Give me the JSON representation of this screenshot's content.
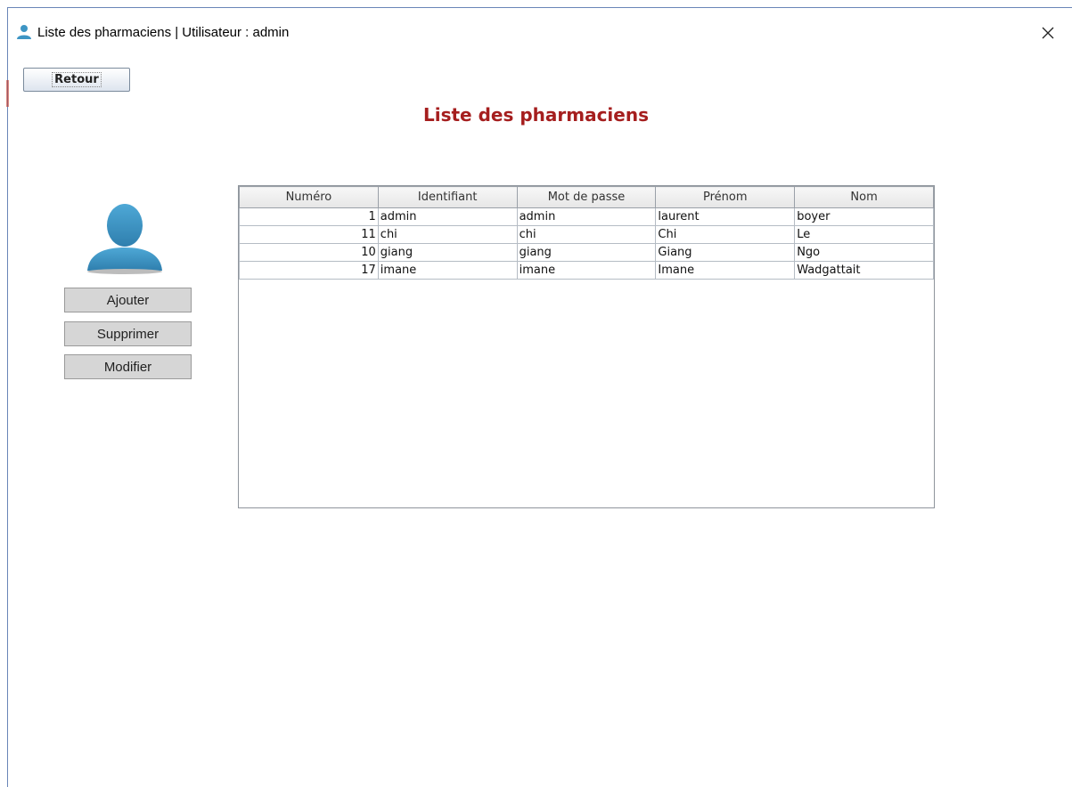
{
  "window": {
    "title": "Liste des pharmaciens | Utilisateur : admin",
    "title_icon": "user-icon",
    "close_icon": "close-icon"
  },
  "toolbar": {
    "back_label": "Retour"
  },
  "main": {
    "heading": "Liste des pharmaciens",
    "heading_color": "#a51e1e",
    "avatar_icon": "user-avatar-icon",
    "avatar_color": "#3d95c4"
  },
  "actions": {
    "add_label": "Ajouter",
    "delete_label": "Supprimer",
    "edit_label": "Modifier"
  },
  "table": {
    "columns": [
      "Numéro",
      "Identifiant",
      "Mot de passe",
      "Prénom",
      "Nom"
    ],
    "rows": [
      [
        "1",
        "admin",
        "admin",
        "laurent",
        "boyer"
      ],
      [
        "11",
        "chi",
        "chi",
        "Chi",
        "Le"
      ],
      [
        "10",
        "giang",
        "giang",
        "Giang",
        "Ngo"
      ],
      [
        "17",
        "imane",
        "imane",
        "Imane",
        "Wadgattait"
      ]
    ]
  }
}
